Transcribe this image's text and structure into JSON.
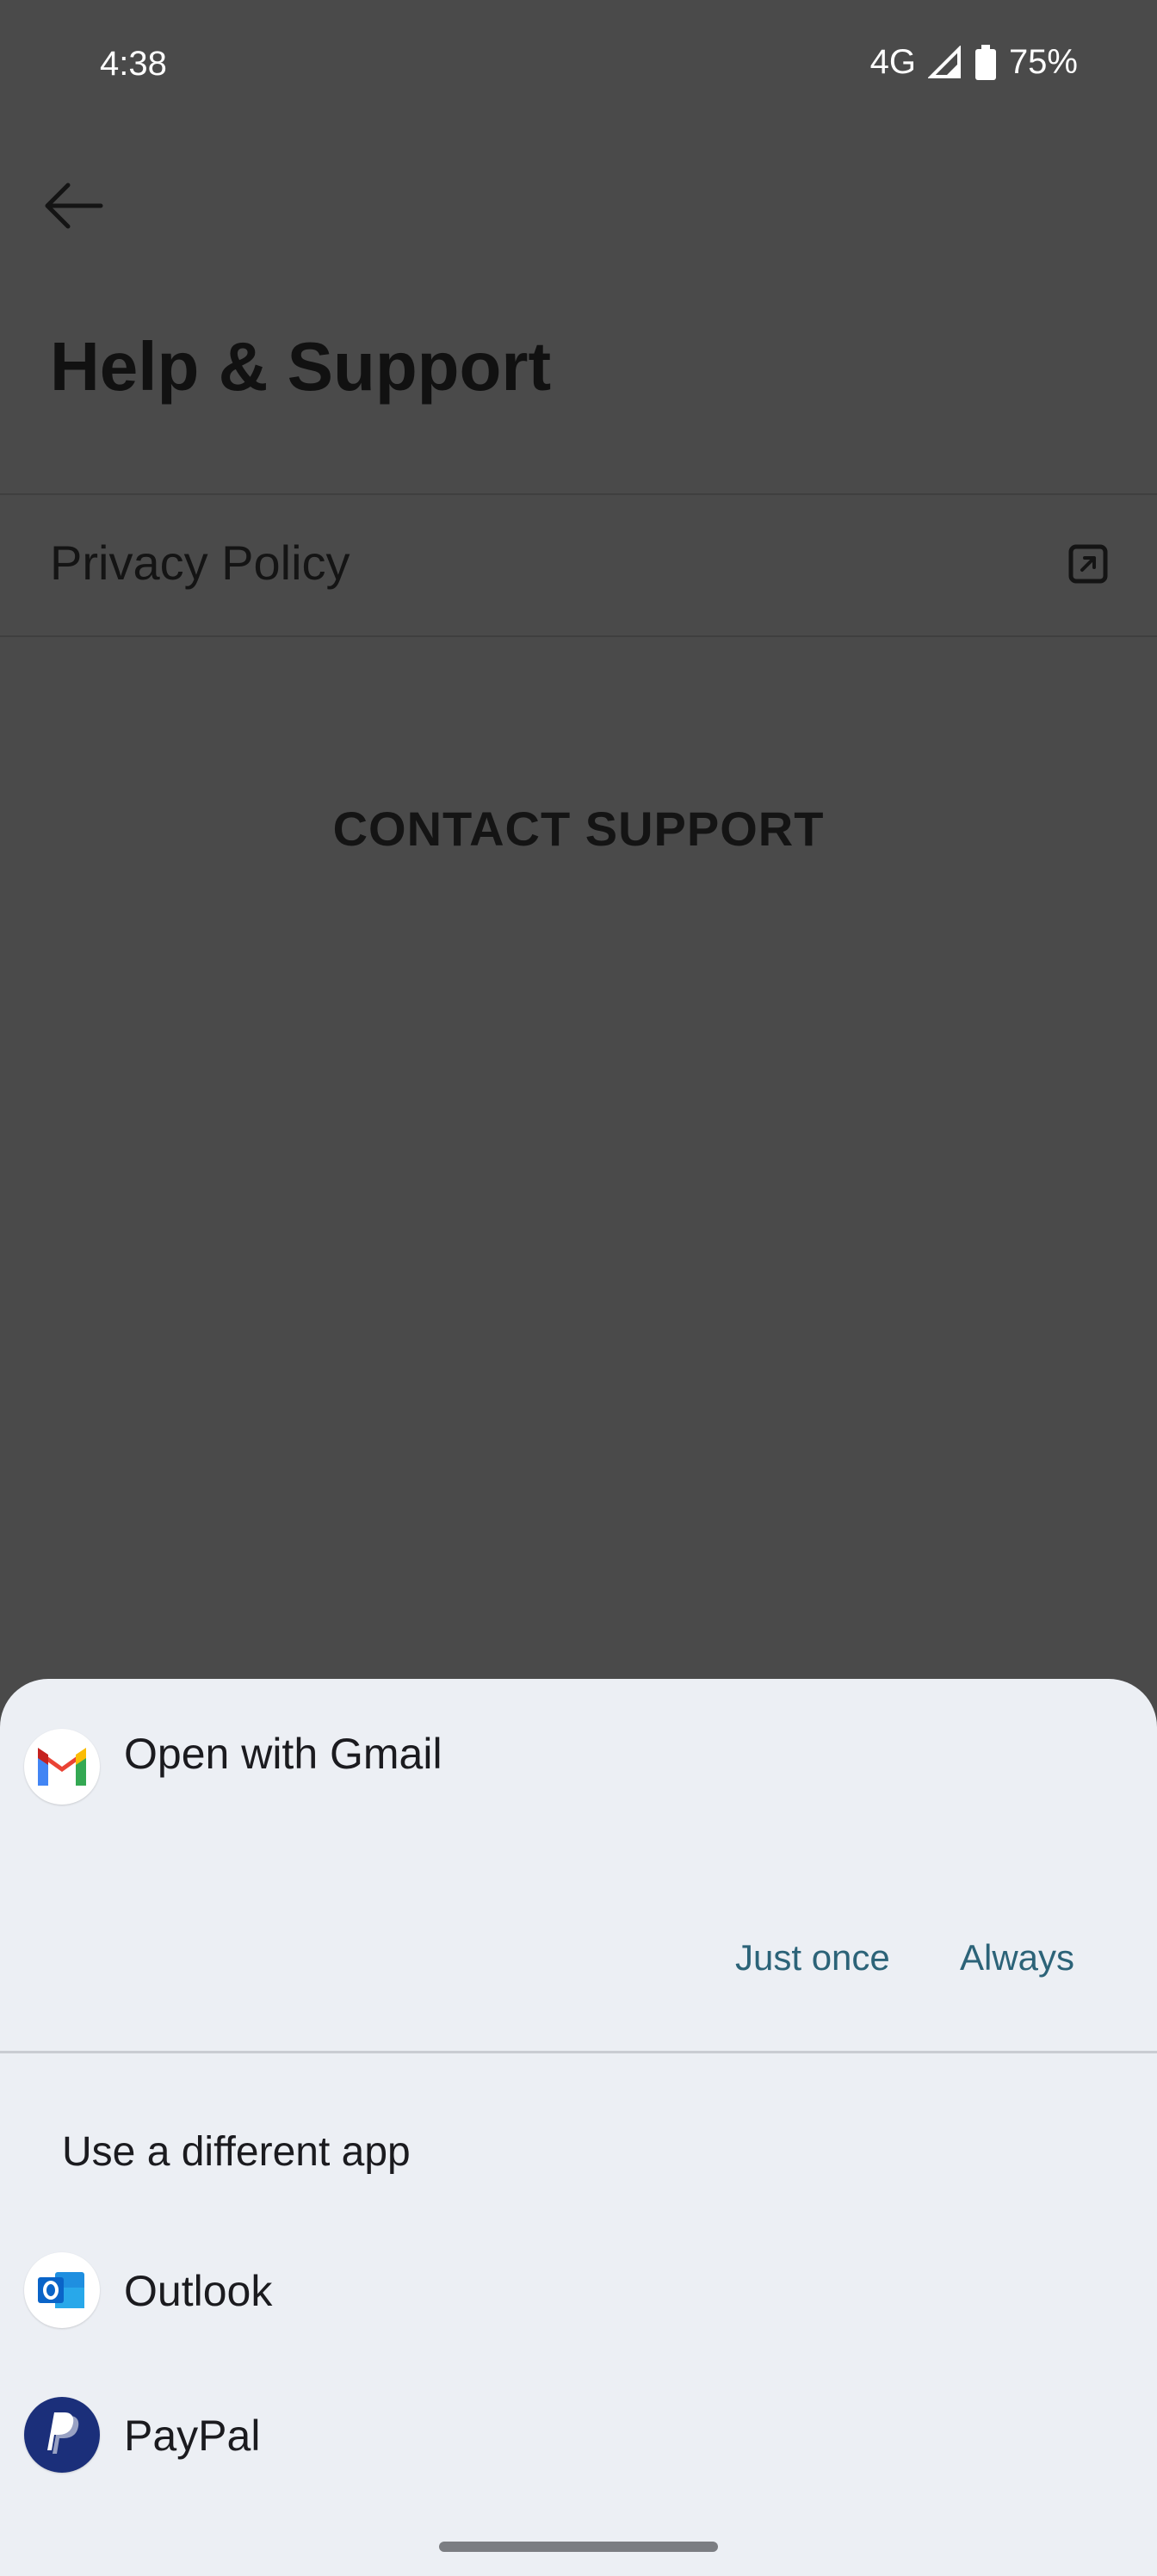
{
  "status_bar": {
    "time": "4:38",
    "network": "4G",
    "battery": "75%"
  },
  "header": {
    "back_icon": "arrow-left-icon",
    "title": "Help & Support"
  },
  "list": {
    "privacy_policy": "Privacy Policy",
    "privacy_policy_icon": "external-link-icon"
  },
  "contact_support": "CONTACT SUPPORT",
  "chooser": {
    "title": "Open with Gmail",
    "title_icon": "gmail-icon",
    "just_once": "Just once",
    "always": "Always",
    "different_app_label": "Use a different app",
    "apps": [
      {
        "name": "Outlook",
        "icon": "outlook-icon"
      },
      {
        "name": "PayPal",
        "icon": "paypal-icon"
      }
    ]
  },
  "colors": {
    "scrim": "#4a4a4a",
    "sheet_bg": "#eceff4",
    "accent": "#2c6378"
  }
}
